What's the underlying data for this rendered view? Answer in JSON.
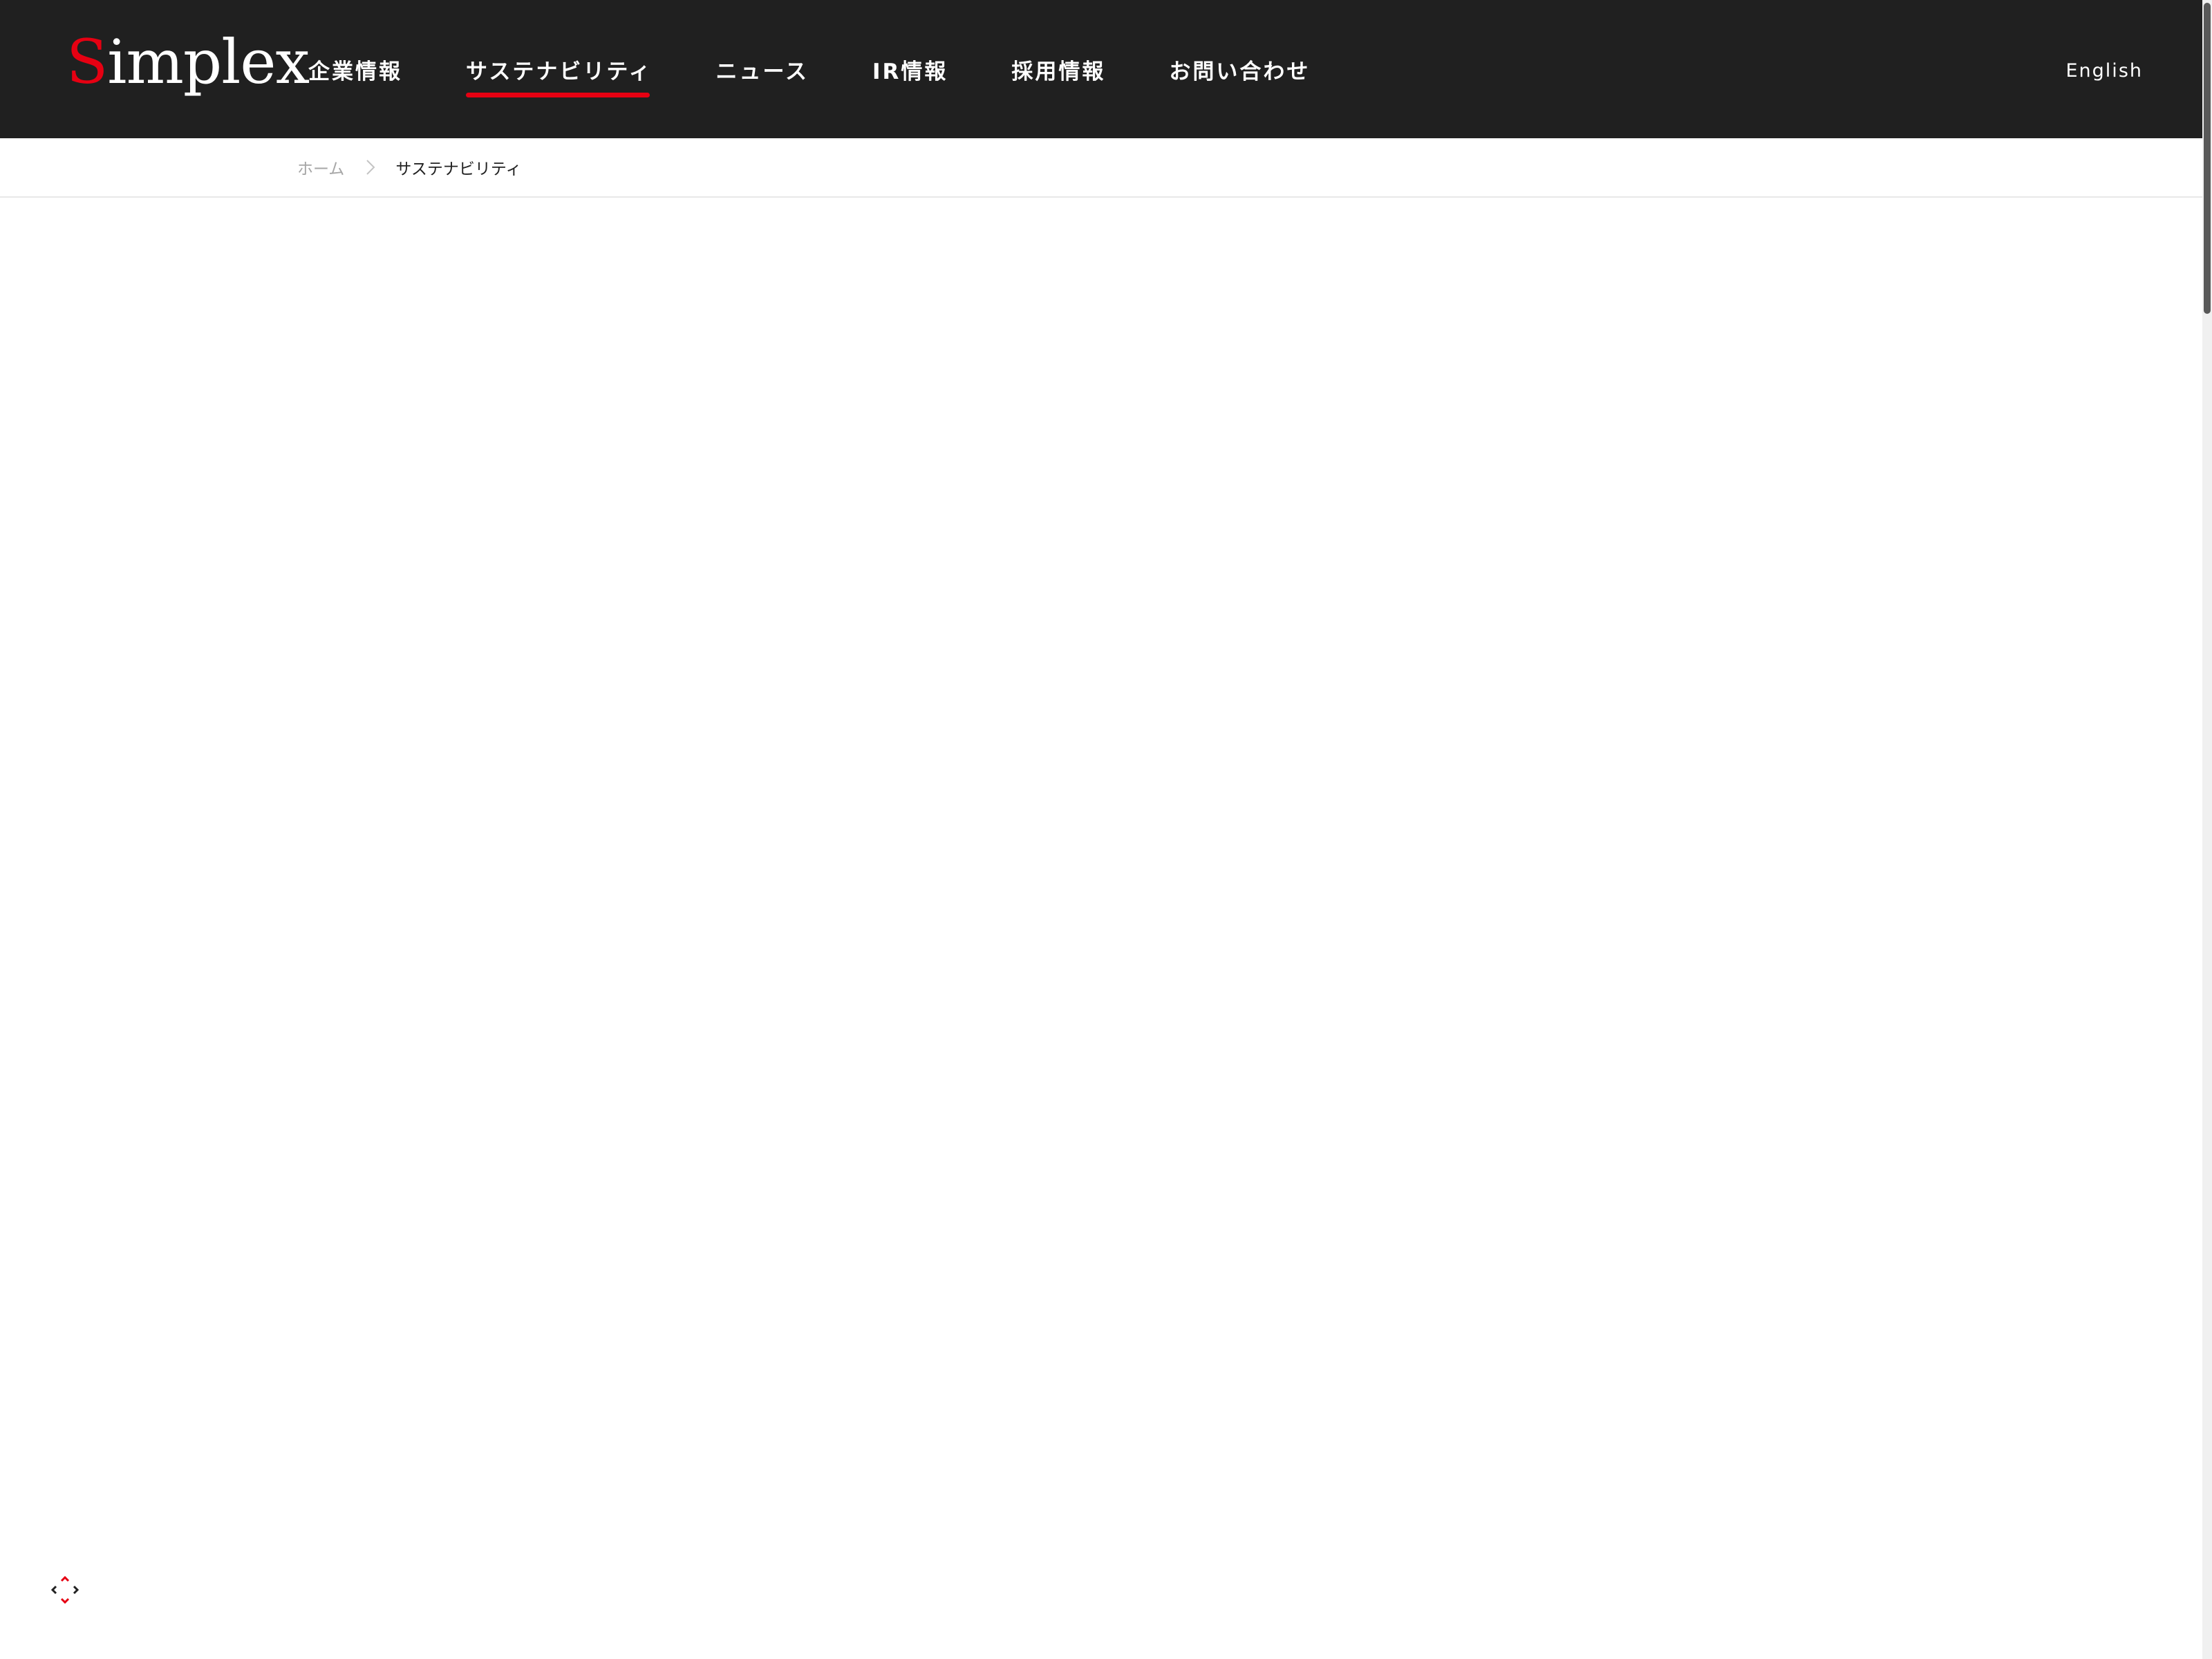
{
  "header": {
    "logo": {
      "first_letter": "S",
      "rest": "implex",
      "first_letter_color": "#e60012"
    },
    "nav": [
      {
        "label": "企業情報",
        "active": false
      },
      {
        "label": "サステナビリティ",
        "active": true
      },
      {
        "label": "ニュース",
        "active": false
      },
      {
        "label": "IR情報",
        "active": false
      },
      {
        "label": "採用情報",
        "active": false
      },
      {
        "label": "お問い合わせ",
        "active": false
      }
    ],
    "language_link": "English",
    "background_color": "#202020",
    "accent_color": "#e60012"
  },
  "breadcrumb": {
    "home": "ホーム",
    "separator_icon": "chevron-right-icon",
    "current": "サステナビリティ"
  },
  "widgets": {
    "bottom_left_icon": "expand-arrows-icon"
  }
}
